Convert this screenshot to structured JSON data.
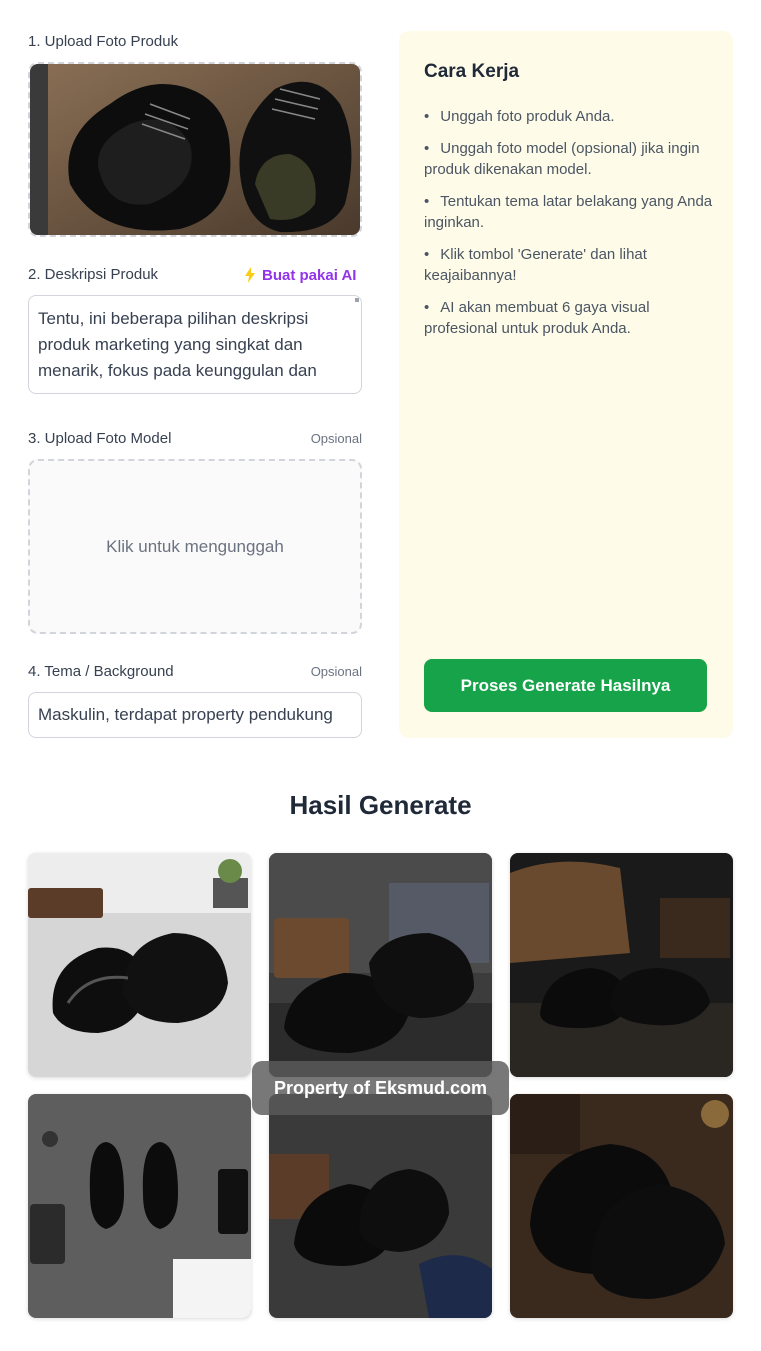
{
  "form": {
    "product_photo_label": "1. Upload Foto Produk",
    "description_label": "2. Deskripsi Produk",
    "ai_button_label": "Buat pakai AI",
    "description_value": "Tentu, ini beberapa pilihan deskripsi produk marketing yang singkat dan menarik, fokus pada keunggulan dan",
    "model_photo_label": "3. Upload Foto Model",
    "model_optional": "Opsional",
    "model_upload_hint": "Klik untuk mengunggah",
    "theme_label": "4. Tema / Background",
    "theme_optional": "Opsional",
    "theme_value": "Maskulin, terdapat property pendukung"
  },
  "how_it_works": {
    "title": "Cara Kerja",
    "steps": [
      "Unggah foto produk Anda.",
      "Unggah foto model (opsional) jika ingin produk dikenakan model.",
      "Tentukan tema latar belakang yang Anda inginkan.",
      "Klik tombol 'Generate' dan lihat keajaibannya!",
      "AI akan membuat 6 gaya visual profesional untuk produk Anda."
    ],
    "generate_button": "Proses Generate Hasilnya"
  },
  "results": {
    "title": "Hasil Generate",
    "watermark": "Property of Eksmud.com"
  },
  "colors": {
    "accent_green": "#16a34a",
    "ai_purple": "#9333ea",
    "panel_bg": "#fefce8"
  }
}
